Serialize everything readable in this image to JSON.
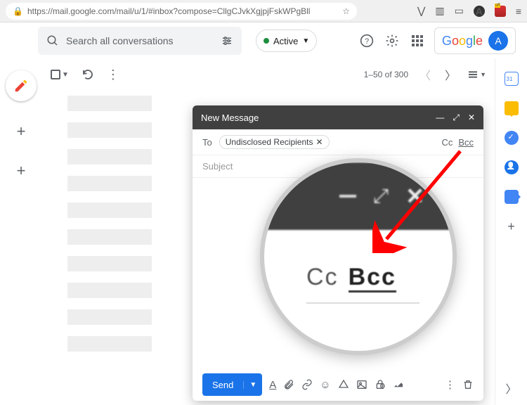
{
  "browser": {
    "url": "https://mail.google.com/mail/u/1/#inbox?compose=CllgCJvkXgjpjFskWPgBll"
  },
  "search": {
    "placeholder": "Search all conversations"
  },
  "status": {
    "active_label": "Active"
  },
  "google": {
    "logo_chars": [
      "G",
      "o",
      "o",
      "g",
      "l",
      "e"
    ],
    "avatar_initial": "A"
  },
  "toolbar": {
    "page_info": "1–50 of 300"
  },
  "compose": {
    "title": "New Message",
    "to_label": "To",
    "recipient": "Undisclosed Recipients",
    "cc_label": "Cc",
    "bcc_label": "Bcc",
    "subject_placeholder": "Subject",
    "send_label": "Send"
  },
  "magnifier": {
    "cc_text": "Cc",
    "bcc_text": "Bcc"
  },
  "sidepanel": {
    "calendar_day": "31"
  }
}
